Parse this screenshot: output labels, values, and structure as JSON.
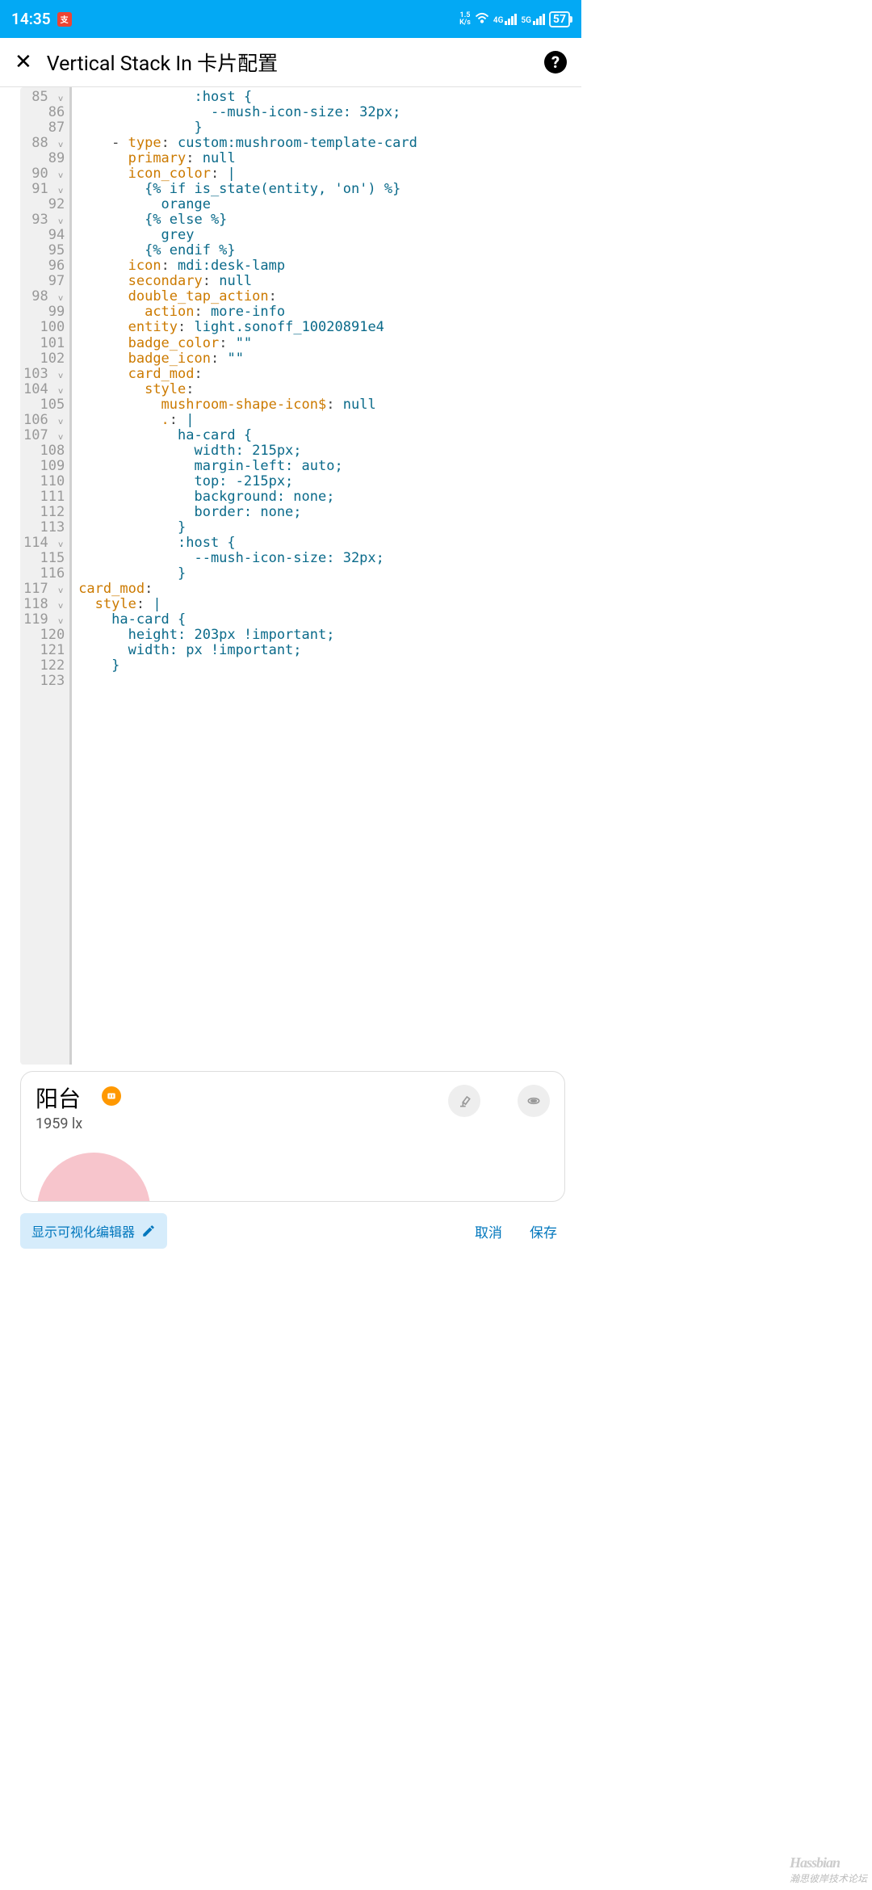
{
  "status": {
    "time": "14:35",
    "speed_top": "1.5",
    "speed_bot": "K/s",
    "net1": "4G",
    "net2": "5G",
    "battery": "57"
  },
  "header": {
    "title": "Vertical Stack In 卡片配置"
  },
  "gutter": " 85 ᵥ\n 86\n 87\n 88 ᵥ\n 89\n 90 ᵥ\n 91 ᵥ\n 92\n 93 ᵥ\n 94\n 95\n 96\n 97\n 98 ᵥ\n 99\n100\n101\n102\n103 ᵥ\n104 ᵥ\n105\n106 ᵥ\n107 ᵥ\n108\n109\n110\n111\n112\n113\n114 ᵥ\n115\n116\n117 ᵥ\n118 ᵥ\n119 ᵥ\n120\n121\n122\n123",
  "code": {
    "l85": {
      "a": "              :host {"
    },
    "l86": {
      "a": "                --mush-icon-size: 32px;"
    },
    "l87": {
      "a": "              }"
    },
    "l88": {
      "p": "    - ",
      "k": "type",
      "c": ": ",
      "v": "custom:mushroom-template-card"
    },
    "l89": {
      "p": "      ",
      "k": "primary",
      "c": ": ",
      "v": "null"
    },
    "l90": {
      "p": "      ",
      "k": "icon_color",
      "c": ": ",
      "v": "|"
    },
    "l91": {
      "a": "        {% if is_state(entity, 'on') %}"
    },
    "l92": {
      "a": "          orange"
    },
    "l93": {
      "a": "        {% else %}"
    },
    "l94": {
      "a": "          grey"
    },
    "l95": {
      "a": "        {% endif %}"
    },
    "l96": {
      "p": "      ",
      "k": "icon",
      "c": ": ",
      "v": "mdi:desk-lamp"
    },
    "l97": {
      "p": "      ",
      "k": "secondary",
      "c": ": ",
      "v": "null"
    },
    "l98": {
      "p": "      ",
      "k": "double_tap_action",
      "c": ":",
      "v": ""
    },
    "l99": {
      "p": "        ",
      "k": "action",
      "c": ": ",
      "v": "more-info"
    },
    "l100": {
      "p": "      ",
      "k": "entity",
      "c": ": ",
      "v": "light.sonoff_10020891e4"
    },
    "l101": {
      "p": "      ",
      "k": "badge_color",
      "c": ": ",
      "v": "\"\""
    },
    "l102": {
      "p": "      ",
      "k": "badge_icon",
      "c": ": ",
      "v": "\"\""
    },
    "l103": {
      "p": "      ",
      "k": "card_mod",
      "c": ":",
      "v": ""
    },
    "l104": {
      "p": "        ",
      "k": "style",
      "c": ":",
      "v": ""
    },
    "l105": {
      "p": "          ",
      "k": "mushroom-shape-icon$",
      "c": ": ",
      "v": "null"
    },
    "l106": {
      "p": "          ",
      "k": ".",
      "c": ": ",
      "v": "|"
    },
    "l107": {
      "a": "            ha-card {"
    },
    "l108": {
      "a": "              width: 215px;"
    },
    "l109": {
      "a": "              margin-left: auto;"
    },
    "l110": {
      "a": "              top: -215px;"
    },
    "l111": {
      "a": "              background: none;"
    },
    "l112": {
      "a": "              border: none;"
    },
    "l113": {
      "a": "            }"
    },
    "l114": {
      "a": "            :host {"
    },
    "l115": {
      "a": "              --mush-icon-size: 32px;"
    },
    "l116": {
      "a": "            }"
    },
    "l117": {
      "p": "",
      "k": "card_mod",
      "c": ":",
      "v": ""
    },
    "l118": {
      "p": "  ",
      "k": "style",
      "c": ": ",
      "v": "|"
    },
    "l119": {
      "a": "    ha-card {"
    },
    "l120": {
      "a": "      height: 203px !important;"
    },
    "l121": {
      "a": "      width: px !important;"
    },
    "l122": {
      "a": "    }"
    },
    "l123": {
      "a": ""
    }
  },
  "preview": {
    "title": "阳台",
    "subtitle": "1959 lx"
  },
  "footer": {
    "visual": "显示可视化编辑器",
    "cancel": "取消",
    "save": "保存"
  },
  "watermark": {
    "brand": "Hassbian",
    "sub": "瀚思彼岸技术论坛"
  }
}
